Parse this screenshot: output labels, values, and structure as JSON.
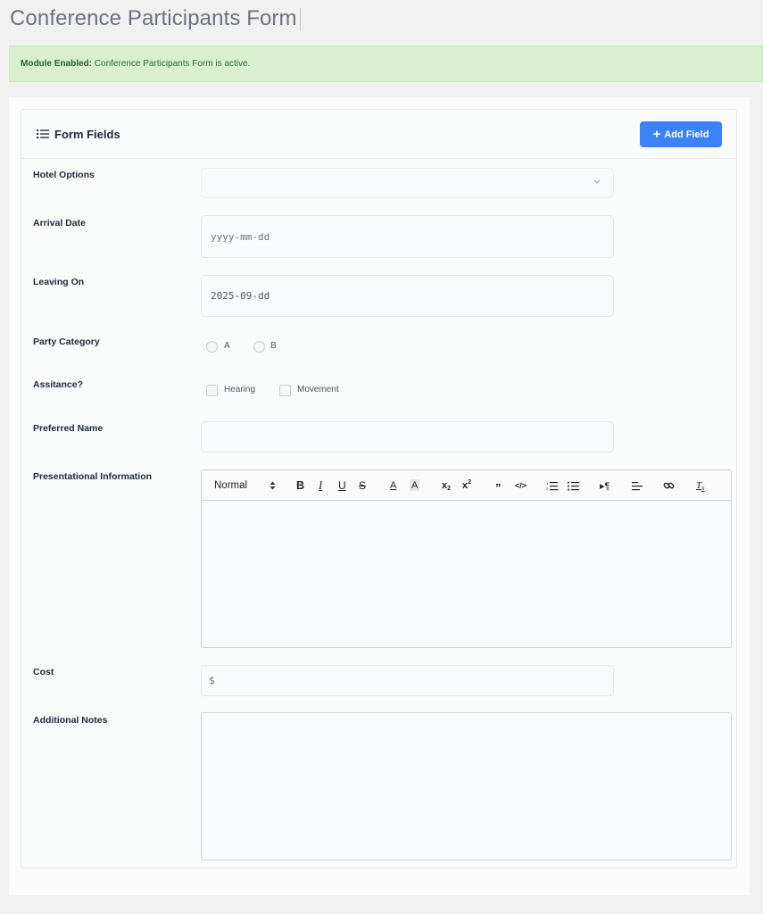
{
  "page": {
    "title": "Conference Participants Form"
  },
  "alert": {
    "label": "Module Enabled:",
    "message": "Conference Participants Form is active."
  },
  "card": {
    "title": "Form Fields",
    "add_button": "Add Field"
  },
  "fields": {
    "hotel": {
      "label": "Hotel Options",
      "value": ""
    },
    "arrival": {
      "label": "Arrival Date",
      "value": "yyyy-mm-dd"
    },
    "leaving": {
      "label": "Leaving On",
      "value": "2025-09-dd"
    },
    "party": {
      "label": "Party Category",
      "options": [
        "A",
        "B"
      ]
    },
    "assistance": {
      "label": "Assitance?",
      "options": [
        "Hearing",
        "Movement"
      ]
    },
    "preferred_name": {
      "label": "Preferred Name",
      "value": ""
    },
    "presentational": {
      "label": "Presentational Information",
      "format": "Normal"
    },
    "cost": {
      "label": "Cost",
      "prefix": "$"
    },
    "notes": {
      "label": "Additional Notes",
      "value": ""
    }
  },
  "colors": {
    "primary": "#3b82f6",
    "alert_bg": "#d9efcf",
    "alert_text": "#2f6b2f"
  }
}
